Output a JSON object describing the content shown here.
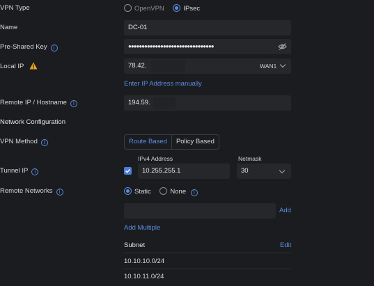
{
  "vpn_type": {
    "label": "VPN Type",
    "options": [
      "OpenVPN",
      "IPsec"
    ],
    "selected": "IPsec"
  },
  "name": {
    "label": "Name",
    "value": "DC-01"
  },
  "psk": {
    "label": "Pre-Shared Key",
    "value": "●●●●●●●●●●●●●●●●●●●●●●●●●●●●●●●●"
  },
  "local_ip": {
    "label": "Local IP",
    "value": "78.42.",
    "interface": "WAN1",
    "manual_link": "Enter IP Address manually"
  },
  "remote_ip": {
    "label": "Remote IP / Hostname",
    "value": "194.59."
  },
  "network_config": {
    "heading": "Network Configuration"
  },
  "vpn_method": {
    "label": "VPN Method",
    "options": [
      "Route Based",
      "Policy Based"
    ],
    "selected": "Route Based"
  },
  "tunnel_ip": {
    "label": "Tunnel IP",
    "checked": true,
    "ipv4_label": "IPv4 Address",
    "ipv4_value": "10.255.255.1",
    "netmask_label": "Netmask",
    "netmask_value": "30"
  },
  "remote_networks": {
    "label": "Remote Networks",
    "options": [
      "Static",
      "None"
    ],
    "selected": "Static",
    "add_label": "Add",
    "add_multiple_label": "Add Multiple",
    "subnet_header": "Subnet",
    "edit_label": "Edit",
    "subnets": [
      "10.10.10.0/24",
      "10.10.11.0/24"
    ]
  },
  "colors": {
    "accent": "#5b8de0",
    "warning": "#f0a020",
    "background": "#1b1c1f",
    "field": "#26272b"
  }
}
